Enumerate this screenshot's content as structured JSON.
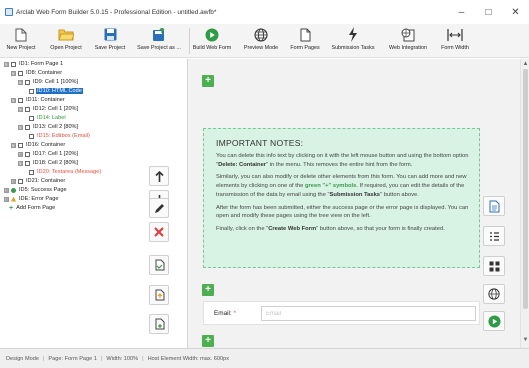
{
  "window": {
    "title": "Arclab Web Form Builder 5.0.15 - Professional Edition - untitled.awfb*",
    "controls": [
      "–",
      "□",
      "✕"
    ]
  },
  "toolbar": {
    "items": [
      {
        "label": "New Project",
        "icon": "new-document-icon"
      },
      {
        "label": "Open Project",
        "icon": "folder-open-icon"
      },
      {
        "label": "Save Project",
        "icon": "floppy-disk-icon"
      },
      {
        "label": "Save Project as ...",
        "icon": "floppy-disk-arrow-icon"
      },
      {
        "label": "Build Web Form",
        "icon": "play-circle-icon"
      },
      {
        "label": "Preview Mode",
        "icon": "globe-icon"
      },
      {
        "label": "Form Pages",
        "icon": "pages-icon"
      },
      {
        "label": "Submission Tasks",
        "icon": "lightning-icon"
      },
      {
        "label": "Web Integration",
        "icon": "web-integration-icon"
      },
      {
        "label": "Form Width",
        "icon": "width-arrows-icon"
      }
    ]
  },
  "tree": {
    "items": [
      {
        "text": "ID1: Form Page 1",
        "level": 0,
        "exp": "⊟"
      },
      {
        "text": "ID8: Container",
        "level": 1,
        "exp": "⊟"
      },
      {
        "text": "ID9: Cell 1 [100%]",
        "level": 2,
        "exp": "⊟"
      },
      {
        "text": "ID10: HTML Code",
        "level": 3,
        "selected": true
      },
      {
        "text": "ID11: Container",
        "level": 1,
        "exp": "⊟"
      },
      {
        "text": "ID12: Cell 1 [20%]",
        "level": 2,
        "exp": "⊟"
      },
      {
        "text": "ID14: Label",
        "level": 3,
        "color": "green"
      },
      {
        "text": "ID13: Cell 2 [80%]",
        "level": 2,
        "exp": "⊟"
      },
      {
        "text": "ID15: Editbox (Email)",
        "level": 3,
        "color": "red"
      },
      {
        "text": "ID16: Container",
        "level": 1,
        "exp": "⊟"
      },
      {
        "text": "ID17: Cell 1 [20%]",
        "level": 2,
        "exp": "⊞"
      },
      {
        "text": "ID18: Cell 2 [80%]",
        "level": 2,
        "exp": "⊟"
      },
      {
        "text": "ID20: Textarea (Message)",
        "level": 3,
        "color": "red"
      },
      {
        "text": "ID21: Container",
        "level": 1,
        "exp": "⊞"
      },
      {
        "text": "ID5: Success Page",
        "level": 0,
        "exp": "⊞",
        "status": "#3a9a4e"
      },
      {
        "text": "IDE: Error Page",
        "level": 0,
        "exp": "⊞",
        "status": "#e0a020"
      },
      {
        "text": "Add Form Page",
        "level": 0,
        "exp": "+"
      }
    ]
  },
  "side_buttons": [
    {
      "name": "move-up-button",
      "icon": "arrow-up-icon"
    },
    {
      "name": "move-down-button",
      "icon": "arrow-down-icon"
    },
    {
      "name": "edit-button",
      "icon": "pencil-icon"
    },
    {
      "name": "delete-button",
      "icon": "red-x-icon"
    },
    {
      "name": "copy-button",
      "icon": "copy-icon"
    },
    {
      "name": "cut-button",
      "icon": "cut-icon"
    },
    {
      "name": "paste-button",
      "icon": "paste-icon"
    }
  ],
  "notes": {
    "heading": "IMPORTANT NOTES:",
    "p1_a": "You can delete this info text by clicking on it with the left mouse button and using the bottom option \"",
    "p1_b": "Delete: Container",
    "p1_c": "\" in the menu. This removes the entire hint from the form.",
    "p2_a": "Similarly, you can also modify or delete other elements from this form. You can add more and new elements by clicking on one of the ",
    "p2_b": "green \"+\" symbols",
    "p2_c": ". If required, you can edit the details of the transmission of the data by email using the \"",
    "p2_d": "Submission Tasks",
    "p2_e": "\" button above.",
    "p3": "After the form has been submitted, either the success page or the error page is displayed. You can open and modify these pages using the tree view on the left.",
    "p4_a": "Finally, click on the \"",
    "p4_b": "Create Web Form",
    "p4_c": "\" button above, so that your form is finally created."
  },
  "right_tools": [
    {
      "name": "form-settings-button",
      "icon": "document-icon"
    },
    {
      "name": "form-list-button",
      "icon": "list-icon"
    },
    {
      "name": "layout-grid-button",
      "icon": "grid-icon"
    },
    {
      "name": "preview-globe-button",
      "icon": "globe-icon"
    },
    {
      "name": "build-run-button",
      "icon": "play-circle-icon"
    }
  ],
  "plus_symbol": "+",
  "email": {
    "label": "Email:",
    "required_mark": "*",
    "placeholder": "Email"
  },
  "statusbar": {
    "mode": "Design Mode",
    "page": "Page: Form Page 1",
    "width": "Width: 100%",
    "host": "Host Element Width: max. 600px"
  },
  "colors": {
    "accent_green": "#4caf50",
    "selection_blue": "#1f6fc5",
    "notes_bg": "#d8f2e4",
    "error_red": "#e35146"
  }
}
